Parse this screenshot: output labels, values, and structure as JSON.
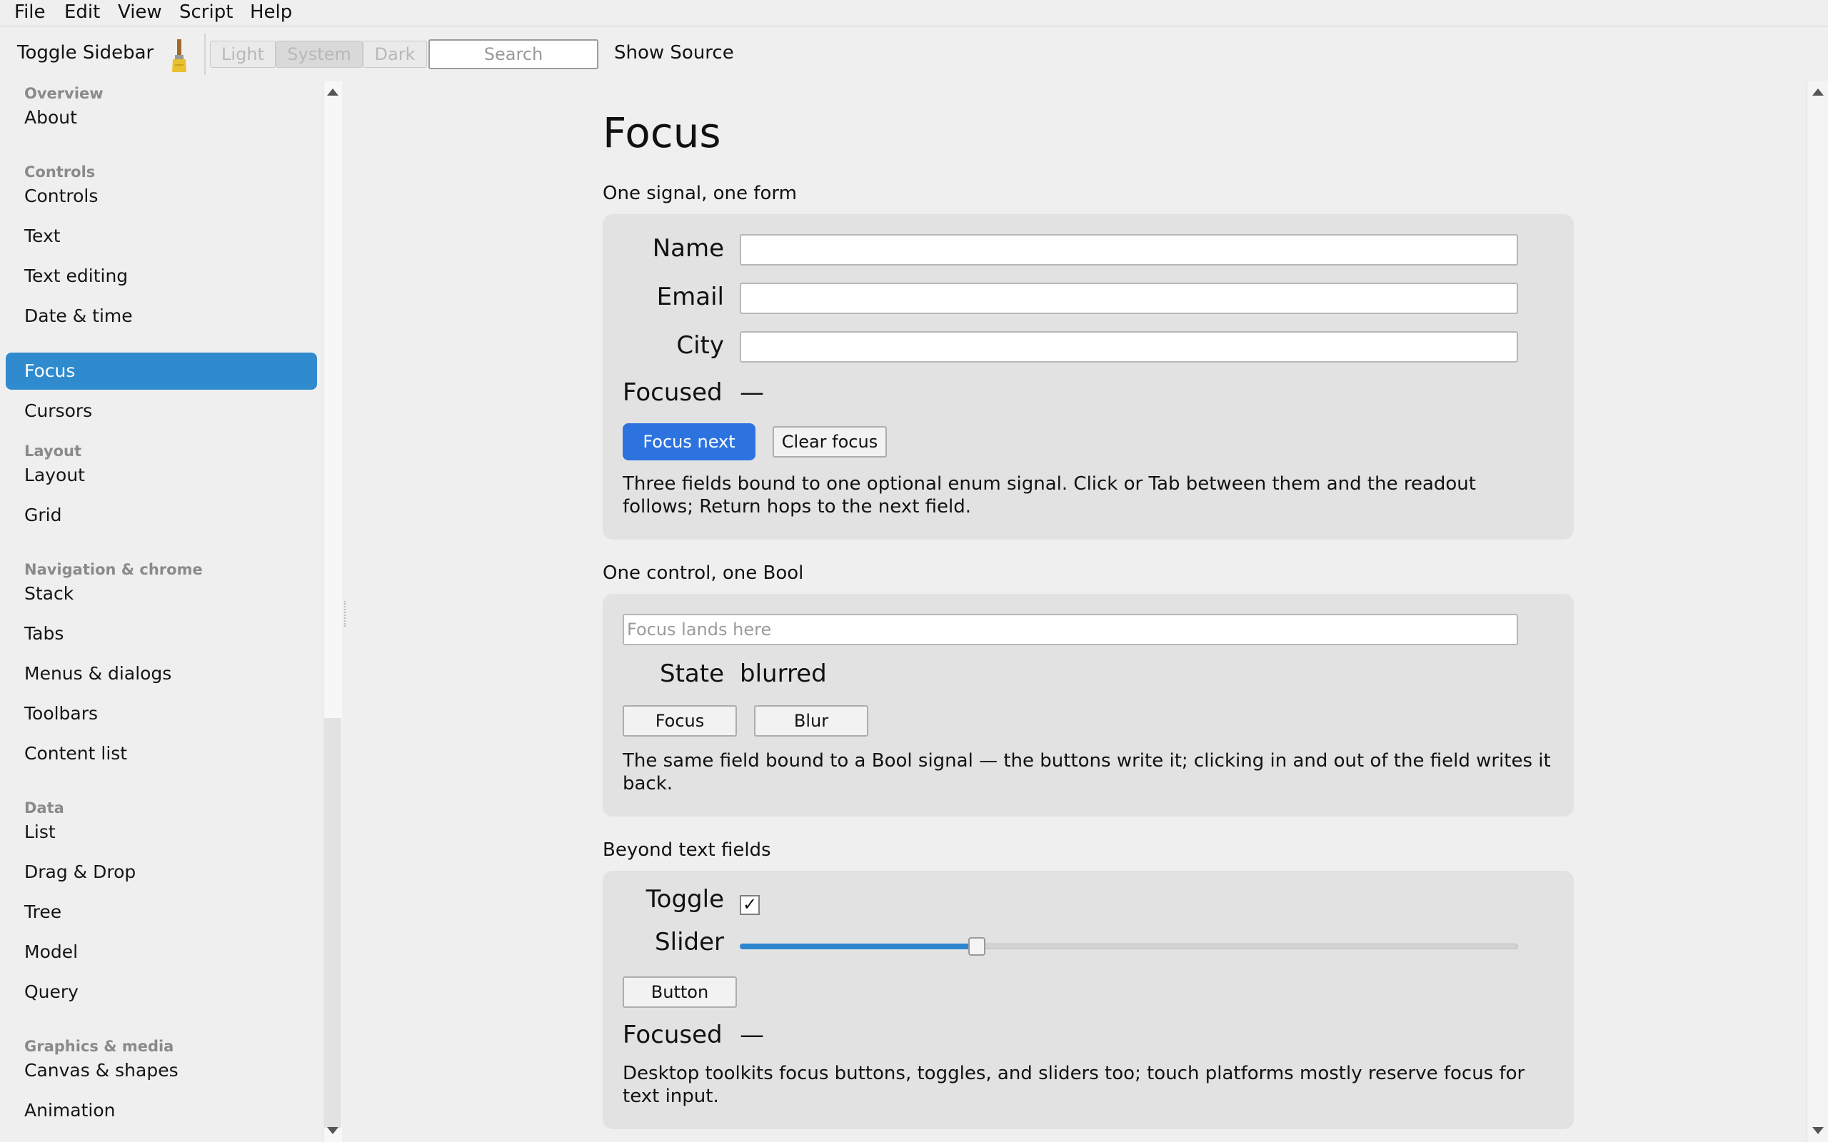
{
  "menubar": {
    "items": [
      "File",
      "Edit",
      "View",
      "Script",
      "Help"
    ]
  },
  "toolbar": {
    "toggle_sidebar": "Toggle Sidebar",
    "theme_light": "Light",
    "theme_system": "System",
    "theme_dark": "Dark",
    "search_placeholder": "Search",
    "show_source": "Show Source",
    "active_theme": "System"
  },
  "sidebar": {
    "selected": "Focus",
    "headers": [
      "Overview",
      "Controls",
      "Layout",
      "Navigation & chrome",
      "Data",
      "Graphics & media"
    ],
    "items": [
      "About",
      "Controls",
      "Text",
      "Text editing",
      "Date & time",
      "Focus",
      "Cursors",
      "Layout",
      "Grid",
      "Stack",
      "Tabs",
      "Menus & dialogs",
      "Toolbars",
      "Content list",
      "List",
      "Drag & Drop",
      "Tree",
      "Model",
      "Query",
      "Canvas & shapes",
      "Animation"
    ]
  },
  "page": {
    "title": "Focus"
  },
  "section1": {
    "title": "One signal, one form",
    "name_label": "Name",
    "email_label": "Email",
    "city_label": "City",
    "name_value": "",
    "email_value": "",
    "city_value": "",
    "focused_label": "Focused",
    "focused_value": "—",
    "focus_next": "Focus next",
    "clear_focus": "Clear focus",
    "description": "Three fields bound to one optional enum signal. Click or Tab between them and the readout follows; Return hops to the next field."
  },
  "section2": {
    "title": "One control, one Bool",
    "placeholder": "Focus lands here",
    "state_label": "State",
    "state_value": "blurred",
    "focus_button": "Focus",
    "blur_button": "Blur",
    "description": "The same field bound to a Bool signal — the buttons write it; clicking in and out of the field writes it back."
  },
  "section3": {
    "title": "Beyond text fields",
    "toggle_label": "Toggle",
    "toggle_checked": true,
    "toggle_glyph": "✓",
    "slider_label": "Slider",
    "slider_value": 0.305,
    "button_label": "Button",
    "focused_label": "Focused",
    "focused_value": "—",
    "description": "Desktop toolkits focus buttons, toggles, and sliders too; touch platforms mostly reserve focus for text input."
  },
  "colors": {
    "accent": "#2d73e0",
    "selection": "#2f8bcd",
    "card": "#e2e2e2",
    "background": "#efefef"
  }
}
